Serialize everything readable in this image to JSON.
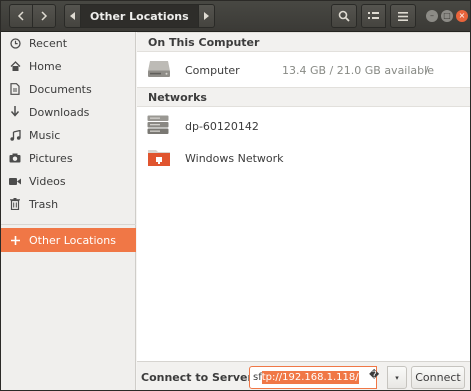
{
  "headerbar": {
    "back_icon": "chevron-left-icon",
    "forward_icon": "chevron-right-icon",
    "path": {
      "current": "Other Locations"
    },
    "search_icon": "search-icon",
    "view_icon": "list-view-icon",
    "menu_icon": "hamburger-menu-icon",
    "window_controls": {
      "minimize": "–",
      "maximize": "□",
      "close": "×"
    }
  },
  "sidebar": {
    "items": [
      {
        "label": "Recent",
        "icon": "clock-icon"
      },
      {
        "label": "Home",
        "icon": "home-icon"
      },
      {
        "label": "Documents",
        "icon": "document-icon"
      },
      {
        "label": "Downloads",
        "icon": "download-icon"
      },
      {
        "label": "Music",
        "icon": "music-icon"
      },
      {
        "label": "Pictures",
        "icon": "camera-icon"
      },
      {
        "label": "Videos",
        "icon": "video-icon"
      },
      {
        "label": "Trash",
        "icon": "trash-icon"
      }
    ],
    "other_locations": {
      "label": "Other Locations",
      "icon": "plus-icon",
      "active": true
    }
  },
  "main": {
    "on_this_computer": {
      "heading": "On This Computer",
      "items": [
        {
          "name": "Computer",
          "info": "13.4 GB / 21.0 GB available",
          "mount": "/",
          "icon": "drive-icon"
        }
      ]
    },
    "networks": {
      "heading": "Networks",
      "items": [
        {
          "name": "dp-60120142",
          "icon": "server-icon"
        },
        {
          "name": "Windows Network",
          "icon": "network-folder-icon"
        }
      ]
    }
  },
  "bottombar": {
    "label": "Connect to Server",
    "input": {
      "prefix": "sf",
      "selected": "tp://192.168.1.118/"
    },
    "clear_glyph": "�",
    "dropdown_glyph": "▾",
    "connect_label": "Connect"
  },
  "colors": {
    "accent": "#f07746",
    "headerbar": "#3c3b37",
    "sidebar": "#f0efed"
  }
}
